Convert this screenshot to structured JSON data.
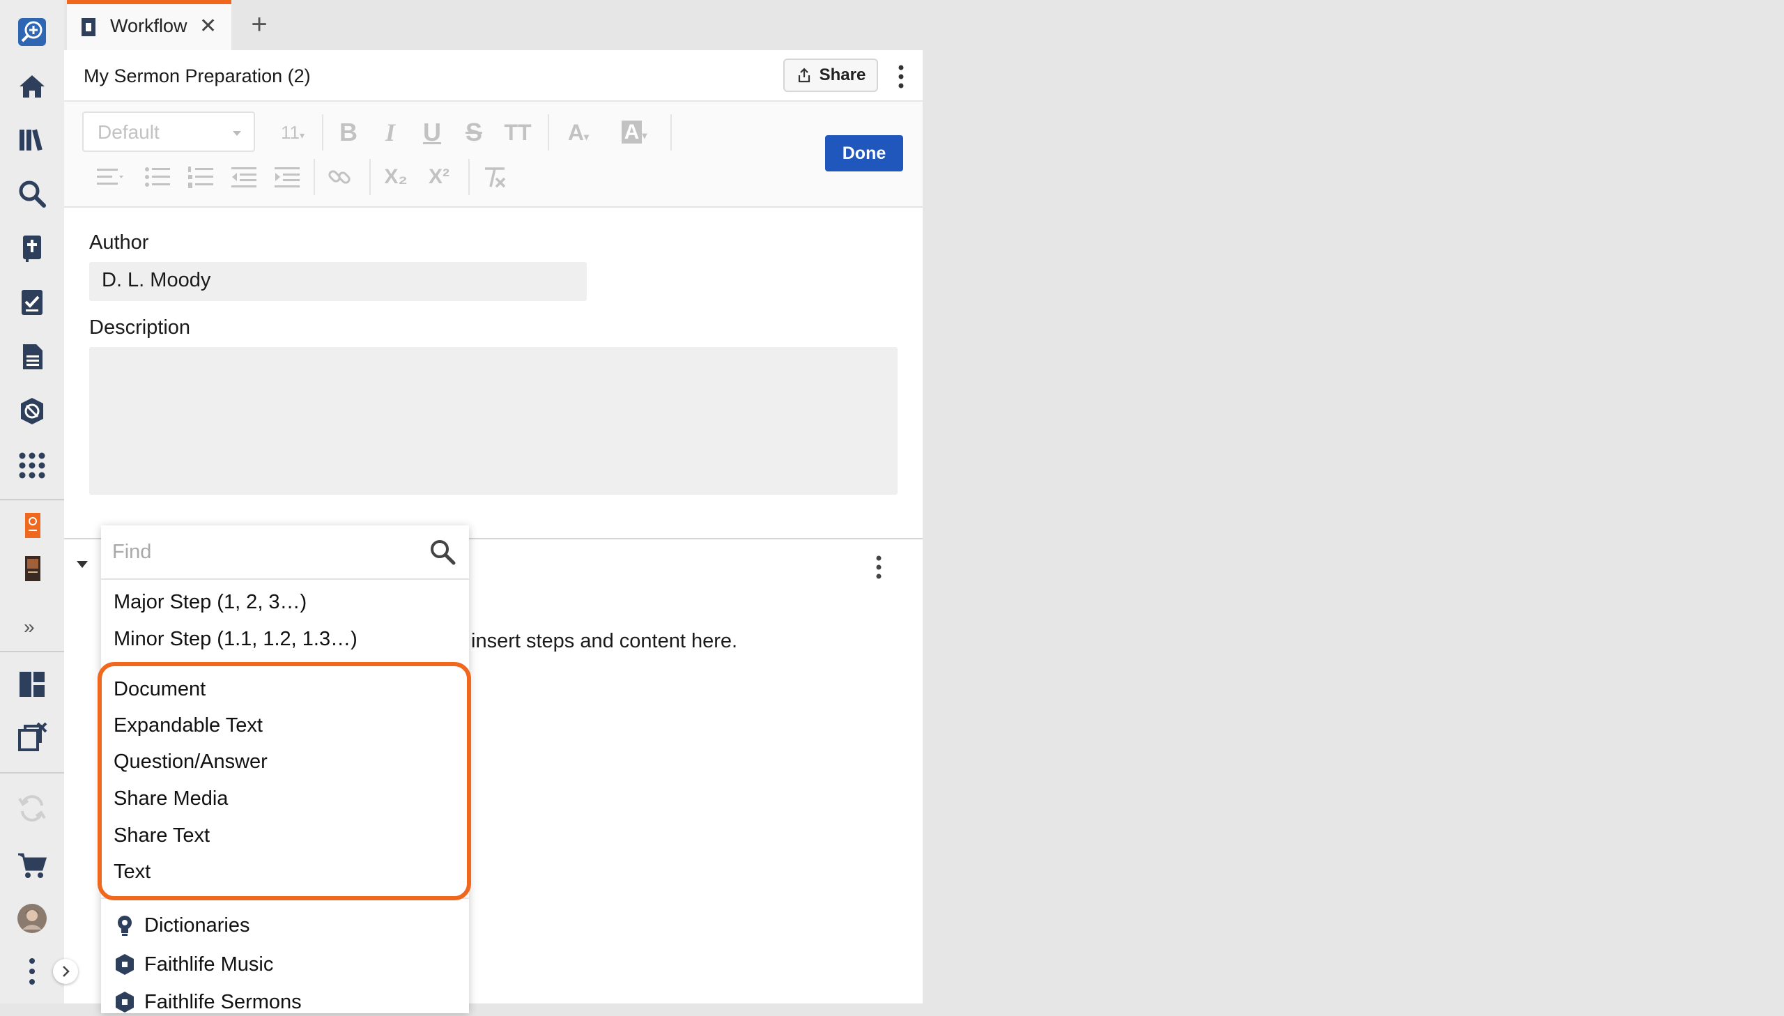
{
  "sidebar": {
    "items": [
      {
        "name": "search-add-icon"
      },
      {
        "name": "home-icon"
      },
      {
        "name": "library-icon"
      },
      {
        "name": "search-icon"
      },
      {
        "name": "bible-icon"
      },
      {
        "name": "checklist-icon"
      },
      {
        "name": "document-icon"
      },
      {
        "name": "atlas-icon"
      },
      {
        "name": "apps-grid-icon"
      },
      {
        "name": "pinned-resource-orange-icon"
      },
      {
        "name": "pinned-resource-book-icon"
      },
      {
        "name": "expand-chevron-icon"
      },
      {
        "name": "layouts-icon"
      },
      {
        "name": "close-all-panels-icon"
      },
      {
        "name": "sync-icon"
      },
      {
        "name": "cart-icon"
      },
      {
        "name": "avatar"
      },
      {
        "name": "more-icon"
      }
    ],
    "expand_label": "»"
  },
  "tabs": [
    {
      "label": "Workflow",
      "close": "✕",
      "active": true
    }
  ],
  "tab_add": "+",
  "panel": {
    "title": "My Sermon Preparation (2)",
    "share_label": "Share",
    "done_label": "Done"
  },
  "toolbar": {
    "style_value": "Default",
    "font_size": "11",
    "bold": "B",
    "italic": "I",
    "underline": "U",
    "strike": "S",
    "text_size": "TT",
    "font_color": "A",
    "highlight": "A",
    "subscript": "X₂",
    "superscript": "X²"
  },
  "form": {
    "author_label": "Author",
    "author_value": "D. L. Moody",
    "description_label": "Description",
    "description_value": ""
  },
  "hint": "insert steps and content here.",
  "dropdown": {
    "find_placeholder": "Find",
    "steps": [
      "Major Step (1, 2, 3…)",
      "Minor Step (1.1, 1.2, 1.3…)"
    ],
    "content": [
      "Document",
      "Expandable Text",
      "Question/Answer",
      "Share Media",
      "Share Text",
      "Text"
    ],
    "resources": [
      "Dictionaries",
      "Faithlife Music",
      "Faithlife Sermons"
    ]
  },
  "colors": {
    "accent": "#f0681e",
    "primary": "#1f57bd",
    "rail_icon": "#2e3f5c"
  }
}
